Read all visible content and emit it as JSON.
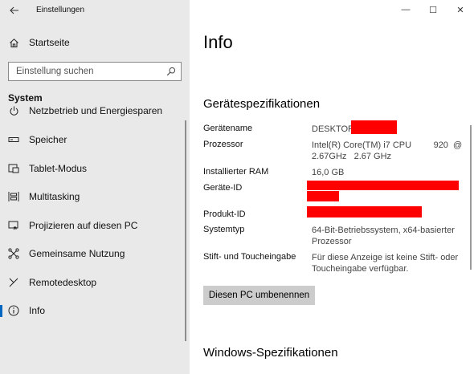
{
  "window": {
    "app_title": "Einstellungen",
    "minimize": "—",
    "maximize": "☐",
    "close": "✕"
  },
  "sidebar": {
    "home_label": "Startseite",
    "search": {
      "placeholder": "Einstellung suchen"
    },
    "section_title": "System",
    "items": [
      {
        "label": "Netzbetrieb und Energiesparen",
        "icon": "power-icon"
      },
      {
        "label": "Speicher",
        "icon": "storage-icon"
      },
      {
        "label": "Tablet-Modus",
        "icon": "tablet-mode-icon"
      },
      {
        "label": "Multitasking",
        "icon": "multitasking-icon"
      },
      {
        "label": "Projizieren auf diesen PC",
        "icon": "project-icon"
      },
      {
        "label": "Gemeinsame Nutzung",
        "icon": "share-icon"
      },
      {
        "label": "Remotedesktop",
        "icon": "remote-desktop-icon"
      },
      {
        "label": "Info",
        "icon": "info-icon",
        "active": true
      }
    ]
  },
  "main": {
    "title": "Info",
    "device_specs_title": "Gerätespezifikationen",
    "specs": [
      {
        "label": "Gerätename",
        "value": "DESKTOP"
      },
      {
        "label": "Prozessor",
        "value": "Intel(R) Core(TM) i7 CPU         920  @ 2.67GHz   2.67 GHz"
      },
      {
        "label": "Installierter RAM",
        "value": "16,0 GB"
      },
      {
        "label": "Geräte-ID",
        "value": ""
      },
      {
        "label": "Produkt-ID",
        "value": ""
      },
      {
        "label": "Systemtyp",
        "value": "64-Bit-Betriebssystem, x64-basierter Prozessor"
      },
      {
        "label": "Stift- und Toucheingabe",
        "value": "Für diese Anzeige ist keine Stift- oder Toucheingabe verfügbar."
      }
    ],
    "rename_button": "Diesen PC umbenennen",
    "windows_specs_title": "Windows-Spezifikationen"
  },
  "colors": {
    "sidebar_bg": "#e9e9e9",
    "accent": "#0067c0",
    "redaction": "#ff0000",
    "button_bg": "#cccccc"
  }
}
